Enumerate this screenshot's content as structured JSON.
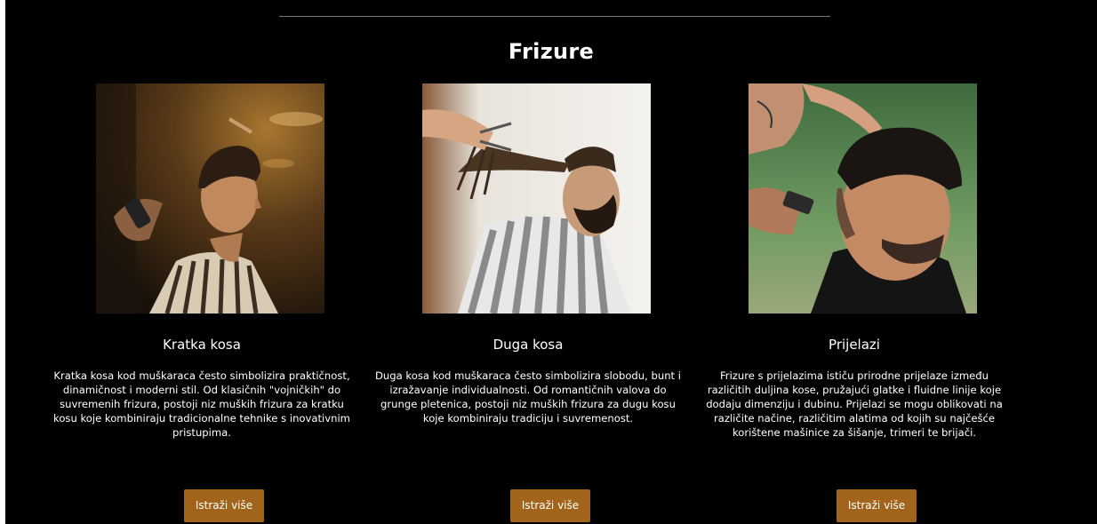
{
  "section": {
    "title": "Frizure"
  },
  "cards": [
    {
      "title": "Kratka kosa",
      "text": "Kratka kosa kod muškaraca često simbolizira praktičnost, dinamičnost i moderni stil. Od klasičnih \"vojničkih\" do suvremenih frizura, postoji niz muških frizura za kratku kosu koje kombiniraju tradicionalne tehnike s inovativnim pristupima.",
      "button": "Istraži više",
      "image": "short-haircut-photo"
    },
    {
      "title": "Duga kosa",
      "text": "Duga kosa kod muškaraca često simbolizira slobodu, bunt i izražavanje individualnosti. Od romantičnih valova do grunge pletenica, postoji niz muških frizura za dugu kosu koje kombiniraju tradiciju i suvremenost.",
      "button": "Istraži više",
      "image": "long-hair-photo"
    },
    {
      "title": "Prijelazi",
      "text": "Frizure s prijelazima ističu prirodne prijelaze između različitih duljina kose, pružajući glatke i fluidne linije koje dodaju dimenziju i dubinu. Prijelazi se mogu oblikovati na različite načine, različitim alatima od kojih su najčešće korištene mašinice za šišanje, trimeri te brijači.",
      "button": "Istraži više",
      "image": "fade-haircut-photo"
    }
  ],
  "colors": {
    "background": "#000000",
    "button": "#a2641b",
    "text": "#ffffff"
  }
}
